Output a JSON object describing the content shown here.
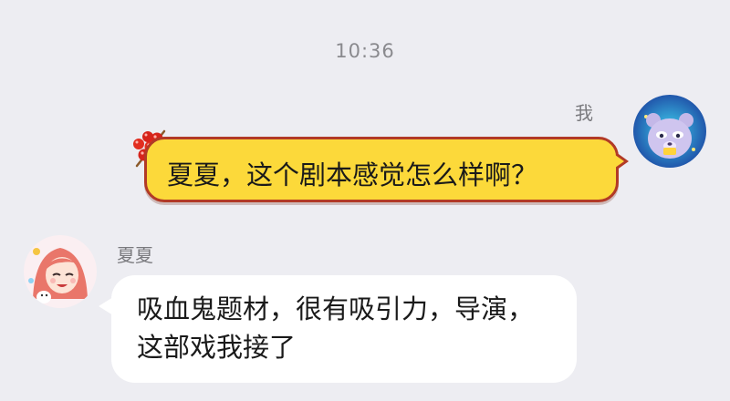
{
  "chat": {
    "timestamp": "10:36",
    "messages": [
      {
        "sender": "我",
        "side": "right",
        "text": "夏夏，这个剧本感觉怎么样啊？",
        "bubble_color": "#fcd93a",
        "border_color": "#b23a26",
        "decoration_icon": "candy-hawthorn-icon",
        "avatar_icon": "bear-avatar-icon"
      },
      {
        "sender": "夏夏",
        "side": "left",
        "text": "吸血鬼题材，很有吸引力，导演，这部戏我接了",
        "bubble_color": "#ffffff",
        "avatar_icon": "girl-avatar-icon"
      }
    ]
  },
  "colors": {
    "background": "#ededf2",
    "timestamp": "#8a8a8e",
    "name": "#7a7a7e"
  }
}
